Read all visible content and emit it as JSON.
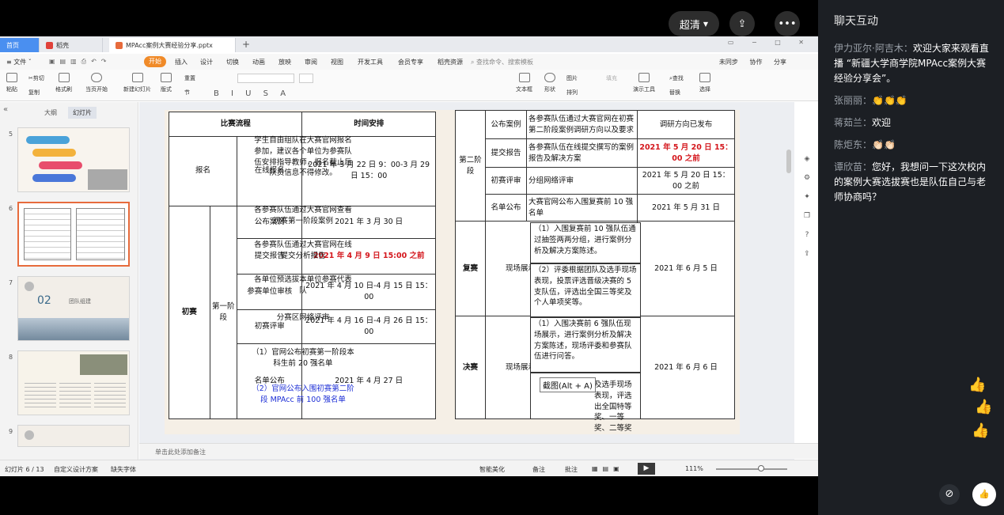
{
  "player": {
    "quality_label": "超清",
    "share_icon": "share-icon",
    "more_icon": "more-icon"
  },
  "tabs": {
    "home": "首页",
    "doc": "稻壳",
    "ppt": "MPAcc案例大赛经验分享.pptx"
  },
  "menu": {
    "file": "≡ 文件 ˇ",
    "items": [
      "开始",
      "插入",
      "设计",
      "切换",
      "动画",
      "放映",
      "审阅",
      "视图",
      "开发工具",
      "会员专享",
      "稻壳资源"
    ],
    "search": "查找命令、搜索模板",
    "right": "未同步 协作 分享"
  },
  "toolbar": {
    "paste": "粘贴",
    "cut": "剪切",
    "copy": "复制",
    "format_painter": "格式刷",
    "from_current": "当页开始",
    "new_slide": "新建幻灯片",
    "layout": "版式",
    "section": "节",
    "reset": "重置",
    "textbox": "文本框",
    "shape": "形状",
    "arrange": "排列",
    "picture": "图片",
    "fill": "填充",
    "present": "演示工具",
    "find": "查找",
    "replace": "替换",
    "select": "选择"
  },
  "panel": {
    "outline_tab": "大纲",
    "slides_tab": "幻灯片",
    "thumb_numbers": [
      "5",
      "6",
      "7",
      "8",
      "9"
    ],
    "thumb7_text": "02",
    "thumb7_sub": "团队组建",
    "add": "+"
  },
  "slide_left": {
    "h1": "比赛流程",
    "h2": "时间安排",
    "rows": {
      "r1_cat": "报名",
      "r1_sub": "在线报名",
      "r1_desc": "学生自由组队在大赛官网报名参加，建议各个单位为参赛队伍安排指导教师，报名截止后队员信息不得修改。",
      "r1_time": "2021 年 3 月 22 日 9：00-3 月 29 日 15：00",
      "cat_first": "初赛",
      "stage1": "第一阶段",
      "r2_sub": "公布案例",
      "r2_desc": "各参赛队伍通过大赛官网查看初赛第一阶段案例",
      "r2_time": "2021 年 3 月 30 日",
      "r3_sub": "提交报告",
      "r3_desc": "各参赛队伍通过大赛官网在线提交分析报告",
      "r3_time": "2021 年 4 月 9 日 15:00 之前",
      "r4_sub": "参赛单位审核",
      "r4_desc": "各单位预选拔本单位参赛代表队",
      "r4_time": "2021 年 4 月 10 日-4 月 15 日 15：00",
      "r5_sub": "初赛评审",
      "r5_desc": "分赛区网络评审",
      "r5_time": "2021 年 4 月 16 日-4 月 26 日 15：00",
      "r6_sub": "名单公布",
      "r6_desc1": "（1）官网公布初赛第一阶段本科生前 20 强名单",
      "r6_desc2": "（2）官网公布入围初赛第二阶段 MPAcc 前 100 强名单",
      "r6_time": "2021 年 4 月 27 日"
    }
  },
  "slide_right": {
    "stage2": "第二阶段",
    "a_sub": "公布案例",
    "a_desc": "各参赛队伍通过大赛官网在初赛第二阶段案例调研方向以及要求",
    "a_time": "调研方向已发布",
    "b_sub": "提交报告",
    "b_desc": "各参赛队伍在线提交撰写的案例报告及解决方案",
    "b_time": "2021 年 5 月 20 日 15：00 之前",
    "c_sub": "初赛评审",
    "c_desc": "分组网络评审",
    "c_time": "2021 年 5 月 20 日 15：00 之前",
    "d_sub": "名单公布",
    "d_desc": "大赛官网公布入围复赛前 10 强名单",
    "d_time": "2021 年 5 月 31 日",
    "semi": "复赛",
    "live": "现场展示",
    "semi_d1": "（1）入围复赛前 10 强队伍通过抽签两两分组，进行案例分析及解决方案陈述。",
    "semi_d2": "（2）评委根据团队及选手现场表现，投票评选晋级决赛的 5 支队伍，评选出全国三等奖及个人单项奖等。",
    "semi_time": "2021 年 6 月 5 日",
    "final": "决赛",
    "final_live": "现场展示",
    "final_d1": "（1）入围决赛前 6 强队伍现场展示，进行案例分析及解决方案陈述，现场评委和参赛队伍进行问答。",
    "final_d2": "及选手现场表现，评选出全国特等奖、一等奖、二等奖及单项奖等。",
    "final_time": "2021 年 6 月 6 日",
    "snip_tip": "截图(Alt + A)"
  },
  "notes_placeholder": "单击此处添加备注",
  "status": {
    "slide_count": "幻灯片 6 / 13",
    "theme": "自定义设计方案",
    "missing_font": "缺失字体",
    "smart_beautify": "智能美化",
    "notes": "备注",
    "comment": "批注",
    "zoom": "111%"
  },
  "chat": {
    "title": "聊天互动",
    "messages": [
      {
        "name": "伊力亚尔·阿吉木：",
        "text": "欢迎大家来观看直播 “新疆大学商学院MPAcc案例大赛经验分享会”。"
      },
      {
        "name": "张丽丽：",
        "text": "👏👏👏"
      },
      {
        "name": "蒋茹兰：",
        "text": "欢迎"
      },
      {
        "name": "陈炬东：",
        "text": "👏🏻👏🏻"
      },
      {
        "name": "谭欣苗：",
        "text": "您好，我想问一下这次校内的案例大赛选拔赛也是队伍自己与老师协商吗？"
      }
    ]
  },
  "colors": {
    "accent_orange": "#f08a28",
    "tab_blue": "#4a8ff0",
    "red_text": "#d4161c",
    "blue_text": "#1d2fd6",
    "chat_bg": "#1c1f24"
  }
}
